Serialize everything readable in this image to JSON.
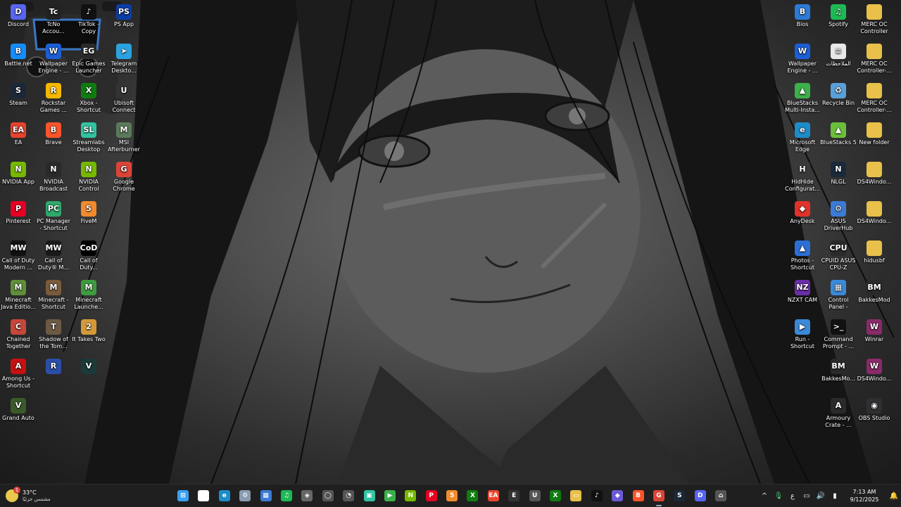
{
  "desktop": {
    "left_icons": [
      {
        "label": "Discord",
        "glyph": "D",
        "color": "#5865f2",
        "icon": "discord-icon"
      },
      {
        "label": "TcNo Accou...",
        "glyph": "Tc",
        "color": "#222",
        "icon": "tcno-icon"
      },
      {
        "label": "TikTok - Copy",
        "glyph": "♪",
        "color": "#111",
        "icon": "tiktok-icon"
      },
      {
        "label": "PS App",
        "glyph": "PS",
        "color": "#0b3ea8",
        "icon": "playstation-icon"
      },
      {
        "label": "Battle.net",
        "glyph": "B",
        "color": "#148eff",
        "icon": "battlenet-icon"
      },
      {
        "label": "Wallpaper Engine - ...",
        "glyph": "W",
        "color": "#1b5fd6",
        "icon": "wallpaper-engine-icon"
      },
      {
        "label": "Epic Games Launcher",
        "glyph": "EG",
        "color": "#2a2a2a",
        "icon": "epic-games-icon"
      },
      {
        "label": "Telegram Deskto...",
        "glyph": "➤",
        "color": "#2aa3df",
        "icon": "telegram-icon"
      },
      {
        "label": "Steam",
        "glyph": "S",
        "color": "#1b2838",
        "icon": "steam-icon"
      },
      {
        "label": "Rockstar Games ...",
        "glyph": "R",
        "color": "#f5b800",
        "icon": "rockstar-icon"
      },
      {
        "label": "Xbox - Shortcut",
        "glyph": "X",
        "color": "#107c10",
        "icon": "xbox-icon"
      },
      {
        "label": "Ubisoft Connect",
        "glyph": "U",
        "color": "#333",
        "icon": "ubisoft-icon"
      },
      {
        "label": "EA",
        "glyph": "EA",
        "color": "#e8442d",
        "icon": "ea-icon"
      },
      {
        "label": "Brave",
        "glyph": "B",
        "color": "#fb542b",
        "icon": "brave-icon"
      },
      {
        "label": "Streamlabs Desktop",
        "glyph": "SL",
        "color": "#31c3a2",
        "icon": "streamlabs-icon"
      },
      {
        "label": "MSI Afterburner",
        "glyph": "M",
        "color": "#5b7a5b",
        "icon": "msi-afterburner-icon"
      },
      {
        "label": "NVIDIA App",
        "glyph": "N",
        "color": "#76b900",
        "icon": "nvidia-icon"
      },
      {
        "label": "NVIDIA Broadcast",
        "glyph": "N",
        "color": "#2a2a2a",
        "icon": "nvidia-broadcast-icon"
      },
      {
        "label": "NVIDIA Control Pan...",
        "glyph": "N",
        "color": "#76b900",
        "icon": "nvidia-control-panel-icon"
      },
      {
        "label": "Google Chrome",
        "glyph": "G",
        "color": "#db4437",
        "icon": "chrome-icon"
      },
      {
        "label": "Pinterest",
        "glyph": "P",
        "color": "#e60023",
        "icon": "pinterest-icon"
      },
      {
        "label": "PC Manager - Shortcut",
        "glyph": "PC",
        "color": "#2fa86b",
        "icon": "pc-manager-icon"
      },
      {
        "label": "FiveM",
        "glyph": "5",
        "color": "#f28b2c",
        "icon": "fivem-icon"
      },
      {
        "label": "",
        "glyph": "",
        "color": "transparent",
        "icon": "empty-slot"
      },
      {
        "label": "Call of Duty Modern ...",
        "glyph": "MW",
        "color": "#111",
        "icon": "cod-modern-icon"
      },
      {
        "label": "Call of Duty® M...",
        "glyph": "MW",
        "color": "#1a1a1a",
        "icon": "cod-mw-icon"
      },
      {
        "label": "Call of Duty...",
        "glyph": "CoD",
        "color": "#000",
        "icon": "cod-icon"
      },
      {
        "label": "",
        "glyph": "",
        "color": "transparent",
        "icon": "empty-slot"
      },
      {
        "label": "Minecraft Java Editio...",
        "glyph": "M",
        "color": "#5f8f3a",
        "icon": "minecraft-java-icon"
      },
      {
        "label": "Minecraft - Shortcut",
        "glyph": "M",
        "color": "#7a5b3a",
        "icon": "minecraft-icon"
      },
      {
        "label": "Minecraft Launche...",
        "glyph": "M",
        "color": "#3f9b3f",
        "icon": "minecraft-launcher-icon"
      },
      {
        "label": "",
        "glyph": "",
        "color": "transparent",
        "icon": "empty-slot"
      },
      {
        "label": "Chained Together",
        "glyph": "C",
        "color": "#c8463a",
        "icon": "chained-together-icon"
      },
      {
        "label": "Shadow of the Tom...",
        "glyph": "T",
        "color": "#6d5a44",
        "icon": "tomb-raider-icon"
      },
      {
        "label": "It Takes Two",
        "glyph": "2",
        "color": "#d49a38",
        "icon": "it-takes-two-icon"
      },
      {
        "label": "",
        "glyph": "",
        "color": "transparent",
        "icon": "empty-slot"
      },
      {
        "label": "Among Us - Shortcut",
        "glyph": "A",
        "color": "#c51111",
        "icon": "among-us-icon"
      },
      {
        "label": "",
        "glyph": "R",
        "color": "#2b4fa8",
        "icon": "rocket-league-icon"
      },
      {
        "label": "",
        "glyph": "V",
        "color": "#1b3a3a",
        "icon": "valorant-icon"
      },
      {
        "label": "",
        "glyph": "",
        "color": "transparent",
        "icon": "empty-slot"
      },
      {
        "label": "Grand Auto",
        "glyph": "V",
        "color": "#3a5a2a",
        "icon": "gta-icon"
      }
    ],
    "right_icons": [
      {
        "label": "Bios",
        "glyph": "B",
        "color": "#2b7bd6",
        "icon": "bios-icon"
      },
      {
        "label": "Spotify",
        "glyph": "♫",
        "color": "#1db954",
        "icon": "spotify-icon"
      },
      {
        "label": "MERC OC Controller",
        "glyph": "",
        "color": "#e8c04a",
        "icon": "folder-icon"
      },
      {
        "label": "Wallpaper Engine - ...",
        "glyph": "W",
        "color": "#1b5fd6",
        "icon": "wallpaper-engine-icon"
      },
      {
        "label": "الملاحظات",
        "glyph": "≡",
        "color": "#e8e8e8",
        "icon": "text-file-icon"
      },
      {
        "label": "MERC OC Controller-...",
        "glyph": "",
        "color": "#e8c04a",
        "icon": "folder-icon"
      },
      {
        "label": "BlueStacks Multi-Insta...",
        "glyph": "▲",
        "color": "#3cb04a",
        "icon": "bluestacks-multi-icon"
      },
      {
        "label": "Recycle Bin",
        "glyph": "♻",
        "color": "#5aa0d8",
        "icon": "recycle-bin-icon"
      },
      {
        "label": "MERC OC Controller-...",
        "glyph": "",
        "color": "#e8c04a",
        "icon": "folder-icon"
      },
      {
        "label": "Microsoft Edge",
        "glyph": "e",
        "color": "#1e8cc8",
        "icon": "edge-icon"
      },
      {
        "label": "BlueStacks 5",
        "glyph": "▲",
        "color": "#6cbf3a",
        "icon": "bluestacks-icon"
      },
      {
        "label": "New folder",
        "glyph": "",
        "color": "#e8c04a",
        "icon": "folder-icon"
      },
      {
        "label": "HidHide Configurat...",
        "glyph": "H",
        "color": "#3a3a3a",
        "icon": "hidhide-icon"
      },
      {
        "label": "NLGL",
        "glyph": "N",
        "color": "#1b2a3a",
        "icon": "nlgl-icon"
      },
      {
        "label": "DS4Windo...",
        "glyph": "",
        "color": "#e8c04a",
        "icon": "folder-icon"
      },
      {
        "label": "AnyDesk",
        "glyph": "◆",
        "color": "#e0322a",
        "icon": "anydesk-icon"
      },
      {
        "label": "ASUS DriverHub",
        "glyph": "⚙",
        "color": "#3b7bd6",
        "icon": "asus-driverhub-icon"
      },
      {
        "label": "DS4Windo...",
        "glyph": "",
        "color": "#e8c04a",
        "icon": "folder-icon"
      },
      {
        "label": "Photos - Shortcut",
        "glyph": "▲",
        "color": "#2b6fd6",
        "icon": "photos-icon"
      },
      {
        "label": "CPUID ASUS CPU-Z",
        "glyph": "CPU",
        "color": "#2a2a2a",
        "icon": "cpuz-icon"
      },
      {
        "label": "hidusbf",
        "glyph": "",
        "color": "#e8c04a",
        "icon": "folder-icon"
      },
      {
        "label": "NZXT CAM",
        "glyph": "NZ",
        "color": "#6a2ea8",
        "icon": "nzxt-cam-icon"
      },
      {
        "label": "Control Panel - Shortcut",
        "glyph": "▦",
        "color": "#3a8ad8",
        "icon": "control-panel-icon"
      },
      {
        "label": "BakkesMod",
        "glyph": "BM",
        "color": "#2a2a2a",
        "icon": "bakkesmod-icon"
      },
      {
        "label": "Run - Shortcut",
        "glyph": "▶",
        "color": "#3a8ad8",
        "icon": "run-icon"
      },
      {
        "label": "Command Prompt - ...",
        "glyph": ">_",
        "color": "#111",
        "icon": "command-prompt-icon"
      },
      {
        "label": "Winrar",
        "glyph": "W",
        "color": "#8a2a6a",
        "icon": "winrar-icon"
      },
      {
        "label": "",
        "glyph": "",
        "color": "transparent",
        "icon": "empty-slot"
      },
      {
        "label": "BakkesMo...",
        "glyph": "BM",
        "color": "#2a2a2a",
        "icon": "bakkesmod-icon"
      },
      {
        "label": "DS4Windo...",
        "glyph": "W",
        "color": "#8a2a6a",
        "icon": "winrar-archive-icon"
      },
      {
        "label": "",
        "glyph": "",
        "color": "transparent",
        "icon": "empty-slot"
      },
      {
        "label": "Armoury Crate - ...",
        "glyph": "A",
        "color": "#2a2a2a",
        "icon": "armoury-crate-icon"
      },
      {
        "label": "OBS Studio",
        "glyph": "◉",
        "color": "#302e31",
        "icon": "obs-icon"
      }
    ]
  },
  "taskbar": {
    "weather": {
      "temp": "33°C",
      "condition": "مشمس جزئيًا",
      "badge": "1"
    },
    "apps": [
      {
        "name": "start-button",
        "glyph": "⊞",
        "color": "#3aa0f0"
      },
      {
        "name": "search-button",
        "glyph": "⌕",
        "color": "#ffffff"
      },
      {
        "name": "edge-taskbar",
        "glyph": "e",
        "color": "#1e8cc8"
      },
      {
        "name": "settings-taskbar",
        "glyph": "⚙",
        "color": "#8a9ab0"
      },
      {
        "name": "store-taskbar",
        "glyph": "▦",
        "color": "#3a7bd6"
      },
      {
        "name": "spotify-taskbar",
        "glyph": "♫",
        "color": "#1db954"
      },
      {
        "name": "unity-taskbar",
        "glyph": "◈",
        "color": "#666"
      },
      {
        "name": "nzxt-taskbar",
        "glyph": "◯",
        "color": "#555"
      },
      {
        "name": "speedometer-taskbar",
        "glyph": "◔",
        "color": "#555"
      },
      {
        "name": "streamlabs-taskbar",
        "glyph": "▣",
        "color": "#31c3a2"
      },
      {
        "name": "play-taskbar",
        "glyph": "▶",
        "color": "#3cb04a"
      },
      {
        "name": "nvidia-taskbar",
        "glyph": "N",
        "color": "#76b900"
      },
      {
        "name": "pinterest-taskbar",
        "glyph": "P",
        "color": "#e60023"
      },
      {
        "name": "fivem-taskbar",
        "glyph": "5",
        "color": "#f28b2c"
      },
      {
        "name": "xbox-taskbar",
        "glyph": "X",
        "color": "#107c10"
      },
      {
        "name": "ea-taskbar",
        "glyph": "EA",
        "color": "#e8442d"
      },
      {
        "name": "epic-taskbar",
        "glyph": "E",
        "color": "#333"
      },
      {
        "name": "ubisoft-taskbar",
        "glyph": "U",
        "color": "#555"
      },
      {
        "name": "xbox-app-taskbar",
        "glyph": "X",
        "color": "#107c10"
      },
      {
        "name": "explorer-taskbar",
        "glyph": "▭",
        "color": "#e8c04a"
      },
      {
        "name": "tiktok-taskbar",
        "glyph": "♪",
        "color": "#111"
      },
      {
        "name": "gamepad-taskbar",
        "glyph": "◆",
        "color": "#6a5ad6"
      },
      {
        "name": "brave-taskbar",
        "glyph": "B",
        "color": "#fb542b"
      },
      {
        "name": "chrome-taskbar",
        "glyph": "G",
        "color": "#db4437"
      },
      {
        "name": "steam-taskbar",
        "glyph": "S",
        "color": "#1b2838"
      },
      {
        "name": "discord-taskbar",
        "glyph": "D",
        "color": "#5865f2"
      },
      {
        "name": "cleaner-taskbar",
        "glyph": "⌂",
        "color": "#555"
      }
    ],
    "tray": {
      "chevron": "^",
      "language": "ع",
      "clock_time": "7:13 AM",
      "clock_date": "9/12/2025"
    }
  }
}
